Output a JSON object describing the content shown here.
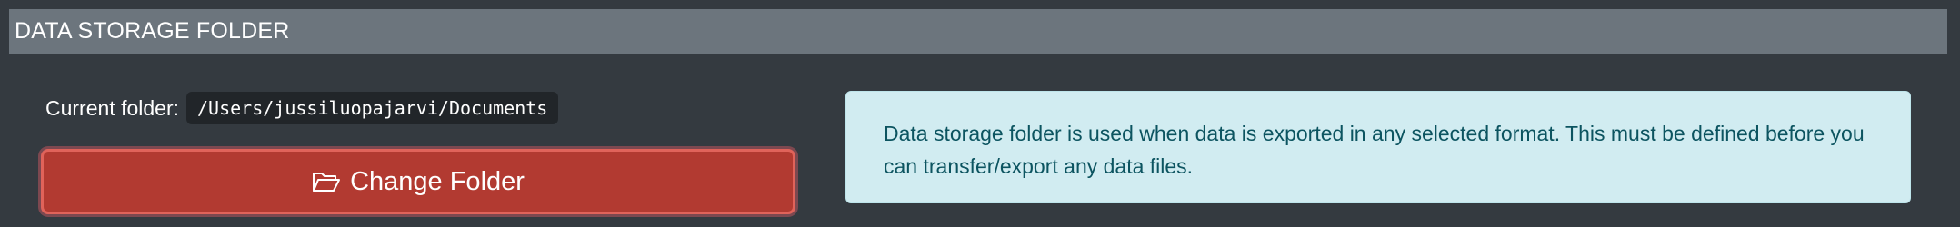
{
  "section": {
    "title": "DATA STORAGE FOLDER"
  },
  "folder": {
    "label": "Current folder:",
    "path": "/Users/jussiluopajarvi/Documents"
  },
  "change_button": {
    "icon": "folder-open-icon",
    "label": "Change Folder"
  },
  "info": {
    "text": "Data storage folder is used when data is exported in any selected format. This must be defined before you can transfer/export any data files."
  },
  "colors": {
    "background": "#343a40",
    "header": "#6c757d",
    "button": "#b23a31",
    "info_background": "#d1ecf1",
    "info_text": "#0c5460"
  }
}
